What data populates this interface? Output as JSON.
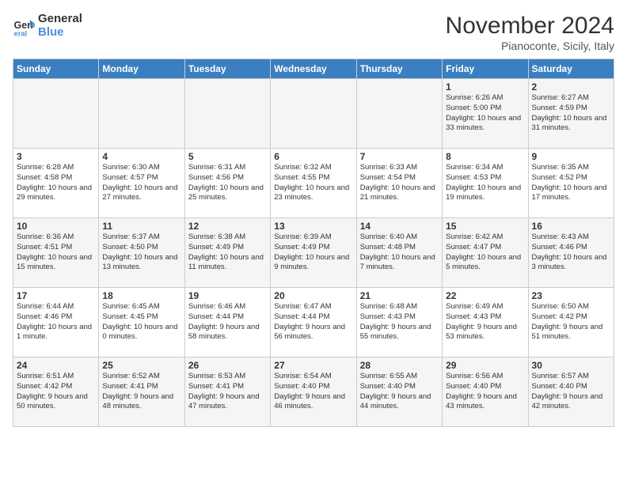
{
  "logo": {
    "line1": "General",
    "line2": "Blue"
  },
  "title": "November 2024",
  "location": "Pianoconte, Sicily, Italy",
  "days_of_week": [
    "Sunday",
    "Monday",
    "Tuesday",
    "Wednesday",
    "Thursday",
    "Friday",
    "Saturday"
  ],
  "weeks": [
    [
      {
        "day": "",
        "info": ""
      },
      {
        "day": "",
        "info": ""
      },
      {
        "day": "",
        "info": ""
      },
      {
        "day": "",
        "info": ""
      },
      {
        "day": "",
        "info": ""
      },
      {
        "day": "1",
        "info": "Sunrise: 6:26 AM\nSunset: 5:00 PM\nDaylight: 10 hours and 33 minutes."
      },
      {
        "day": "2",
        "info": "Sunrise: 6:27 AM\nSunset: 4:59 PM\nDaylight: 10 hours and 31 minutes."
      }
    ],
    [
      {
        "day": "3",
        "info": "Sunrise: 6:28 AM\nSunset: 4:58 PM\nDaylight: 10 hours and 29 minutes."
      },
      {
        "day": "4",
        "info": "Sunrise: 6:30 AM\nSunset: 4:57 PM\nDaylight: 10 hours and 27 minutes."
      },
      {
        "day": "5",
        "info": "Sunrise: 6:31 AM\nSunset: 4:56 PM\nDaylight: 10 hours and 25 minutes."
      },
      {
        "day": "6",
        "info": "Sunrise: 6:32 AM\nSunset: 4:55 PM\nDaylight: 10 hours and 23 minutes."
      },
      {
        "day": "7",
        "info": "Sunrise: 6:33 AM\nSunset: 4:54 PM\nDaylight: 10 hours and 21 minutes."
      },
      {
        "day": "8",
        "info": "Sunrise: 6:34 AM\nSunset: 4:53 PM\nDaylight: 10 hours and 19 minutes."
      },
      {
        "day": "9",
        "info": "Sunrise: 6:35 AM\nSunset: 4:52 PM\nDaylight: 10 hours and 17 minutes."
      }
    ],
    [
      {
        "day": "10",
        "info": "Sunrise: 6:36 AM\nSunset: 4:51 PM\nDaylight: 10 hours and 15 minutes."
      },
      {
        "day": "11",
        "info": "Sunrise: 6:37 AM\nSunset: 4:50 PM\nDaylight: 10 hours and 13 minutes."
      },
      {
        "day": "12",
        "info": "Sunrise: 6:38 AM\nSunset: 4:49 PM\nDaylight: 10 hours and 11 minutes."
      },
      {
        "day": "13",
        "info": "Sunrise: 6:39 AM\nSunset: 4:49 PM\nDaylight: 10 hours and 9 minutes."
      },
      {
        "day": "14",
        "info": "Sunrise: 6:40 AM\nSunset: 4:48 PM\nDaylight: 10 hours and 7 minutes."
      },
      {
        "day": "15",
        "info": "Sunrise: 6:42 AM\nSunset: 4:47 PM\nDaylight: 10 hours and 5 minutes."
      },
      {
        "day": "16",
        "info": "Sunrise: 6:43 AM\nSunset: 4:46 PM\nDaylight: 10 hours and 3 minutes."
      }
    ],
    [
      {
        "day": "17",
        "info": "Sunrise: 6:44 AM\nSunset: 4:46 PM\nDaylight: 10 hours and 1 minute."
      },
      {
        "day": "18",
        "info": "Sunrise: 6:45 AM\nSunset: 4:45 PM\nDaylight: 10 hours and 0 minutes."
      },
      {
        "day": "19",
        "info": "Sunrise: 6:46 AM\nSunset: 4:44 PM\nDaylight: 9 hours and 58 minutes."
      },
      {
        "day": "20",
        "info": "Sunrise: 6:47 AM\nSunset: 4:44 PM\nDaylight: 9 hours and 56 minutes."
      },
      {
        "day": "21",
        "info": "Sunrise: 6:48 AM\nSunset: 4:43 PM\nDaylight: 9 hours and 55 minutes."
      },
      {
        "day": "22",
        "info": "Sunrise: 6:49 AM\nSunset: 4:43 PM\nDaylight: 9 hours and 53 minutes."
      },
      {
        "day": "23",
        "info": "Sunrise: 6:50 AM\nSunset: 4:42 PM\nDaylight: 9 hours and 51 minutes."
      }
    ],
    [
      {
        "day": "24",
        "info": "Sunrise: 6:51 AM\nSunset: 4:42 PM\nDaylight: 9 hours and 50 minutes."
      },
      {
        "day": "25",
        "info": "Sunrise: 6:52 AM\nSunset: 4:41 PM\nDaylight: 9 hours and 48 minutes."
      },
      {
        "day": "26",
        "info": "Sunrise: 6:53 AM\nSunset: 4:41 PM\nDaylight: 9 hours and 47 minutes."
      },
      {
        "day": "27",
        "info": "Sunrise: 6:54 AM\nSunset: 4:40 PM\nDaylight: 9 hours and 46 minutes."
      },
      {
        "day": "28",
        "info": "Sunrise: 6:55 AM\nSunset: 4:40 PM\nDaylight: 9 hours and 44 minutes."
      },
      {
        "day": "29",
        "info": "Sunrise: 6:56 AM\nSunset: 4:40 PM\nDaylight: 9 hours and 43 minutes."
      },
      {
        "day": "30",
        "info": "Sunrise: 6:57 AM\nSunset: 4:40 PM\nDaylight: 9 hours and 42 minutes."
      }
    ]
  ]
}
